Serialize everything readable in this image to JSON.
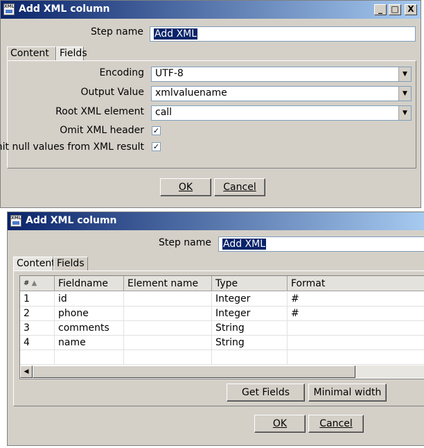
{
  "window1": {
    "title": "Add XML column",
    "icon": "xml-file-icon",
    "controls": {
      "minimize": "_",
      "maximize": "□",
      "close": "X"
    },
    "step_name_label": "Step name",
    "step_name_value": "Add XML",
    "tabs": [
      "Content",
      "Fields"
    ],
    "active_tab": "Content",
    "encoding_label": "Encoding",
    "encoding_value": "UTF-8",
    "output_value_label": "Output Value",
    "output_value_value": "xmlvaluename",
    "root_element_label": "Root XML element",
    "root_element_value": "call",
    "omit_header_label": "Omit XML header",
    "omit_header_checked": true,
    "omit_null_label": "Omit null values from XML result",
    "omit_null_checked": true,
    "ok_label": "OK",
    "cancel_label": "Cancel"
  },
  "window2": {
    "title": "Add XML column",
    "icon": "xml-file-icon",
    "step_name_label": "Step name",
    "step_name_value": "Add XML",
    "tabs": [
      "Content",
      "Fields"
    ],
    "active_tab": "Fields",
    "table": {
      "columns": [
        "#",
        "Fieldname",
        "Element name",
        "Type",
        "Format"
      ],
      "rows": [
        {
          "num": "1",
          "fieldname": "id",
          "element": "",
          "type": "Integer",
          "format": "#"
        },
        {
          "num": "2",
          "fieldname": "phone",
          "element": "",
          "type": "Integer",
          "format": "#"
        },
        {
          "num": "3",
          "fieldname": "comments",
          "element": "",
          "type": "String",
          "format": ""
        },
        {
          "num": "4",
          "fieldname": "name",
          "element": "",
          "type": "String",
          "format": ""
        }
      ]
    },
    "get_fields_label": "Get Fields",
    "minimal_width_label": "Minimal width",
    "ok_label": "OK",
    "cancel_label": "Cancel"
  }
}
